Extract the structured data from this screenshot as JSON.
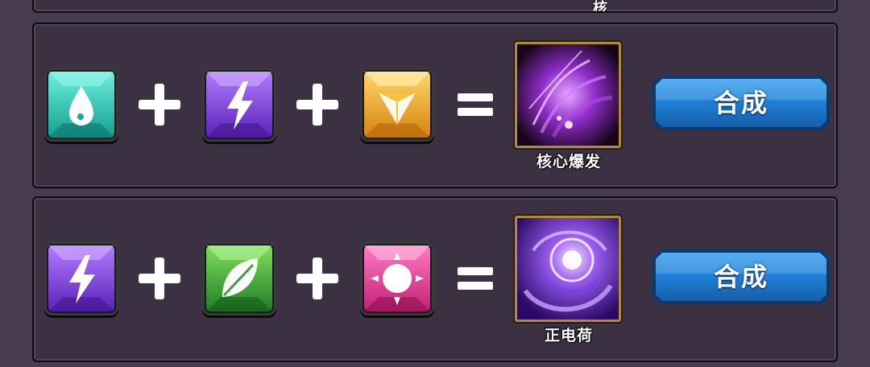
{
  "top_panel": {
    "partial_label": "核"
  },
  "recipes": [
    {
      "ingredients": [
        {
          "gem": "water-gem",
          "color": "#2fc9b8"
        },
        {
          "gem": "lightning-gem",
          "color": "#8a4fe0"
        },
        {
          "gem": "crystal-gem",
          "color": "#f0a51c"
        }
      ],
      "plus_symbol": "+",
      "equals_symbol": "=",
      "result": {
        "name": "核心爆发",
        "icon": "core-burst-icon"
      },
      "button_label": "合成"
    },
    {
      "ingredients": [
        {
          "gem": "lightning-gem",
          "color": "#8a4fe0"
        },
        {
          "gem": "leaf-gem",
          "color": "#3aa23a"
        },
        {
          "gem": "sun-gem",
          "color": "#e23b8e"
        }
      ],
      "plus_symbol": "+",
      "equals_symbol": "=",
      "result": {
        "name": "正电荷",
        "icon": "positive-charge-icon"
      },
      "button_label": "合成"
    }
  ]
}
